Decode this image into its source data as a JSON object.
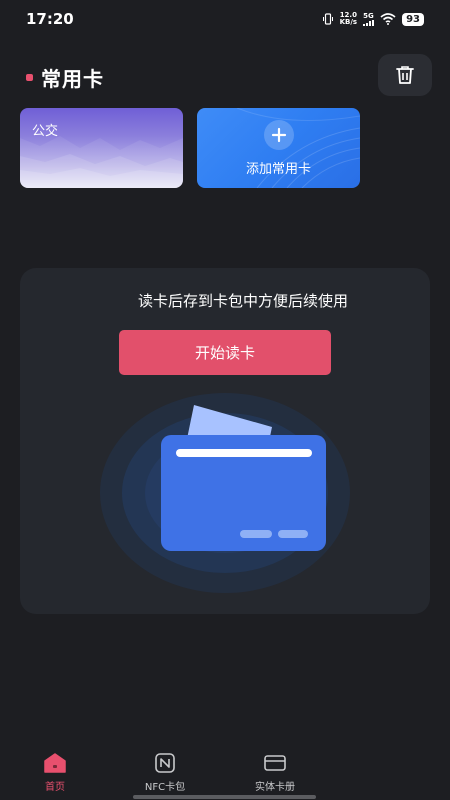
{
  "status_bar": {
    "time": "17:20",
    "net_speed_value": "12.0",
    "net_speed_unit": "KB/s",
    "network_type": "5G",
    "battery": "93"
  },
  "header": {
    "title": "常用卡",
    "delete_icon": "trash-icon"
  },
  "cards": [
    {
      "label": "公交"
    },
    {
      "label": "添加常用卡",
      "icon": "plus-icon"
    }
  ],
  "read_panel": {
    "hint": "读卡后存到卡包中方便后续使用",
    "button_label": "开始读卡"
  },
  "tabs": [
    {
      "label": "首页",
      "icon": "home-icon",
      "active": true
    },
    {
      "label": "NFC卡包",
      "icon": "nfc-icon",
      "active": false
    },
    {
      "label": "实体卡册",
      "icon": "card-icon",
      "active": false
    }
  ],
  "colors": {
    "background": "#1d1e22",
    "accent": "#e8506e",
    "card_blue": "#2f7ef2",
    "card_purple": "#6f5fd6"
  }
}
